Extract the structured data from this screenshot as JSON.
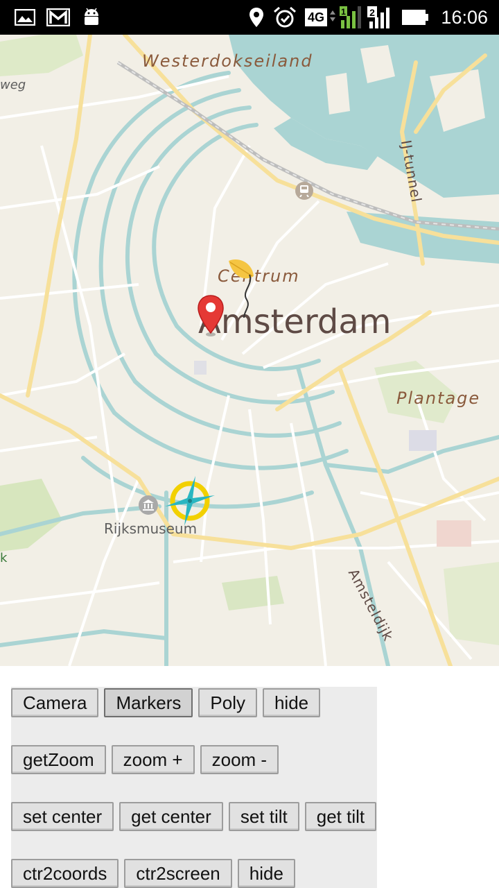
{
  "status_bar": {
    "time": "16:06",
    "icons": [
      "image-icon",
      "gmail-icon",
      "android-icon",
      "location-icon",
      "alarm-icon",
      "4g-icon",
      "signal-sim1-icon",
      "signal-sim2-icon",
      "battery-icon"
    ],
    "network_label": "4G",
    "sim1_label": "1",
    "sim2_label": "2"
  },
  "map": {
    "labels": {
      "westerdokseiland": "Westerdokseiland",
      "ij_tunnel": "IJ-tunnel",
      "centrum": "Centrum",
      "amsterdam": "Amsterdam",
      "plantage": "Plantage",
      "rijksmuseum": "Rijksmuseum",
      "amsteldijk": "Amsteldijk",
      "weg_partial": "weg",
      "k_partial": "k"
    },
    "colors": {
      "land": "#f2efe6",
      "water": "#aad4d3",
      "road_major": "#f7e09a",
      "road_minor": "#ffffff",
      "park": "#cfe3b4",
      "label_dark": "#5e4a45",
      "label_district": "#8a5a3c",
      "marker_red": "#e53935",
      "compass_yellow": "#f2d000",
      "compass_teal": "#2ab6c1"
    }
  },
  "controls": {
    "row1": [
      "Camera",
      "Markers",
      "Poly",
      "hide"
    ],
    "row2": [
      "getZoom",
      "zoom +",
      "zoom -"
    ],
    "row3": [
      "set center",
      "get center",
      "set tilt",
      "get tilt"
    ],
    "row4": [
      "ctr2coords",
      "ctr2screen",
      "hide"
    ]
  }
}
